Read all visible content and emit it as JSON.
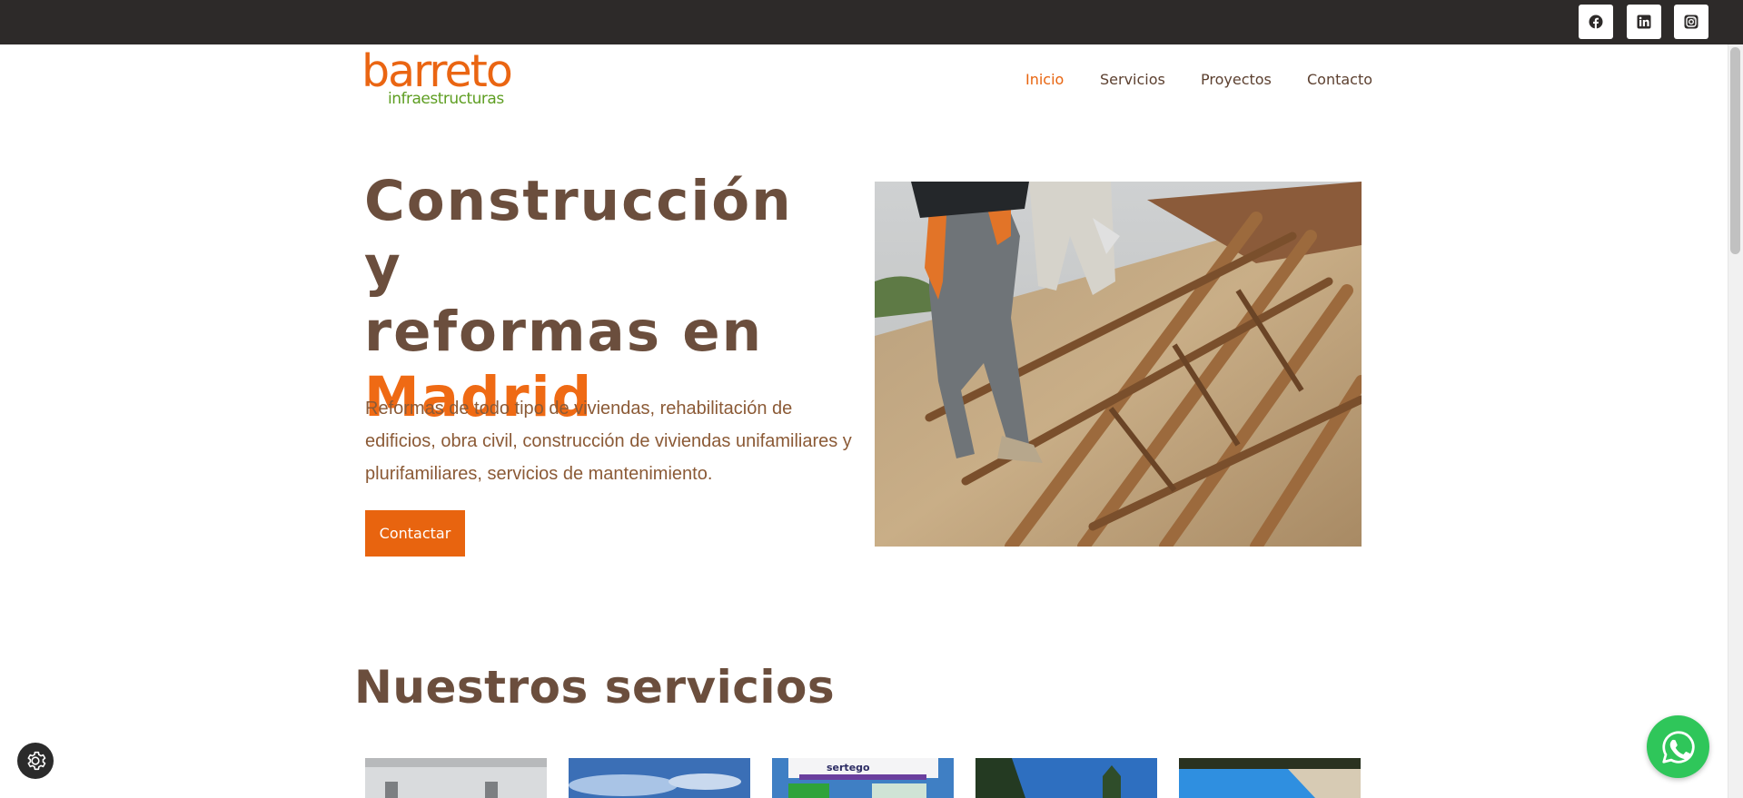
{
  "topbar": {
    "social": [
      {
        "name": "facebook",
        "icon": "facebook-icon"
      },
      {
        "name": "linkedin",
        "icon": "linkedin-icon"
      },
      {
        "name": "instagram",
        "icon": "instagram-icon"
      }
    ]
  },
  "header": {
    "logo_main": "barreto",
    "logo_sub": "infraestructuras",
    "nav": [
      "Inicio",
      "Servicios",
      "Proyectos",
      "Contacto"
    ],
    "active_nav": "Inicio"
  },
  "hero": {
    "title_line1": "Construcción y",
    "title_line2": "reformas en",
    "title_accent": "Madrid",
    "description": "Reformas de todo tipo de viviendas, rehabilitación de edificios, obra civil, construcción de viviendas unifamiliares y plurifamiliares, servicios de mantenimiento.",
    "button_label": "Contactar",
    "image": "roof-construction-workers-photo"
  },
  "services": {
    "title": "Nuestros servicios",
    "cards": [
      {
        "image": "interior-ceiling-photo"
      },
      {
        "image": "sky-building-photo"
      },
      {
        "image": "sertego-sign-photo",
        "brand_text": "sertego"
      },
      {
        "image": "trees-sky-photo"
      },
      {
        "image": "swimming-pool-photo"
      }
    ]
  },
  "widgets": {
    "cookie_icon": "gear-icon",
    "whatsapp_icon": "whatsapp-icon"
  },
  "colors": {
    "accent": "#e8640f",
    "brown": "#6b4e3d",
    "topbar": "#2d2a29",
    "logo_green": "#5e9e22",
    "whatsapp": "#2fc65a"
  }
}
